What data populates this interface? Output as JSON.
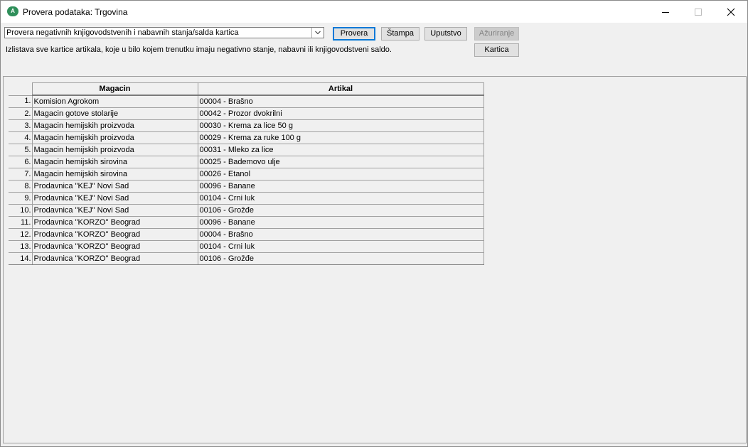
{
  "window": {
    "title": "Provera podataka: Trgovina",
    "app_icon": "app-logo-icon"
  },
  "toolbar": {
    "check_type": "Provera negativnih knjigovodstvenih i nabavnih stanja/salda kartica",
    "provera_label": "Provera",
    "stampa_label": "Štampa",
    "uputstvo_label": "Uputstvo",
    "azuriranje_label": "Ažuriranje",
    "kartica_label": "Kartica"
  },
  "description": "Izlistava sve kartice artikala, koje u bilo kojem trenutku imaju negativno stanje, nabavni ili knjigovodstveni saldo.",
  "table": {
    "columns": [
      "Magacin",
      "Artikal"
    ],
    "rows": [
      {
        "num": "1.",
        "magacin": "Komision Agrokom",
        "artikal": "00004 - Brašno"
      },
      {
        "num": "2.",
        "magacin": "Magacin gotove stolarije",
        "artikal": "00042 - Prozor dvokrilni"
      },
      {
        "num": "3.",
        "magacin": "Magacin hemijskih proizvoda",
        "artikal": "00030 - Krema za lice 50 g"
      },
      {
        "num": "4.",
        "magacin": "Magacin hemijskih proizvoda",
        "artikal": "00029 - Krema za ruke 100 g"
      },
      {
        "num": "5.",
        "magacin": "Magacin hemijskih proizvoda",
        "artikal": "00031 - Mleko za lice"
      },
      {
        "num": "6.",
        "magacin": "Magacin hemijskih sirovina",
        "artikal": "00025 - Bademovo ulje"
      },
      {
        "num": "7.",
        "magacin": "Magacin hemijskih sirovina",
        "artikal": "00026 - Etanol"
      },
      {
        "num": "8.",
        "magacin": "Prodavnica \"KEJ\" Novi Sad",
        "artikal": "00096 - Banane"
      },
      {
        "num": "9.",
        "magacin": "Prodavnica \"KEJ\" Novi Sad",
        "artikal": "00104 - Crni luk"
      },
      {
        "num": "10.",
        "magacin": "Prodavnica \"KEJ\" Novi Sad",
        "artikal": "00106 - Grožđe"
      },
      {
        "num": "11.",
        "magacin": "Prodavnica \"KORZO\" Beograd",
        "artikal": "00096 - Banane"
      },
      {
        "num": "12.",
        "magacin": "Prodavnica \"KORZO\" Beograd",
        "artikal": "00004 - Brašno"
      },
      {
        "num": "13.",
        "magacin": "Prodavnica \"KORZO\" Beograd",
        "artikal": "00104 - Crni luk"
      },
      {
        "num": "14.",
        "magacin": "Prodavnica \"KORZO\" Beograd",
        "artikal": "00106 - Grožđe"
      }
    ]
  }
}
